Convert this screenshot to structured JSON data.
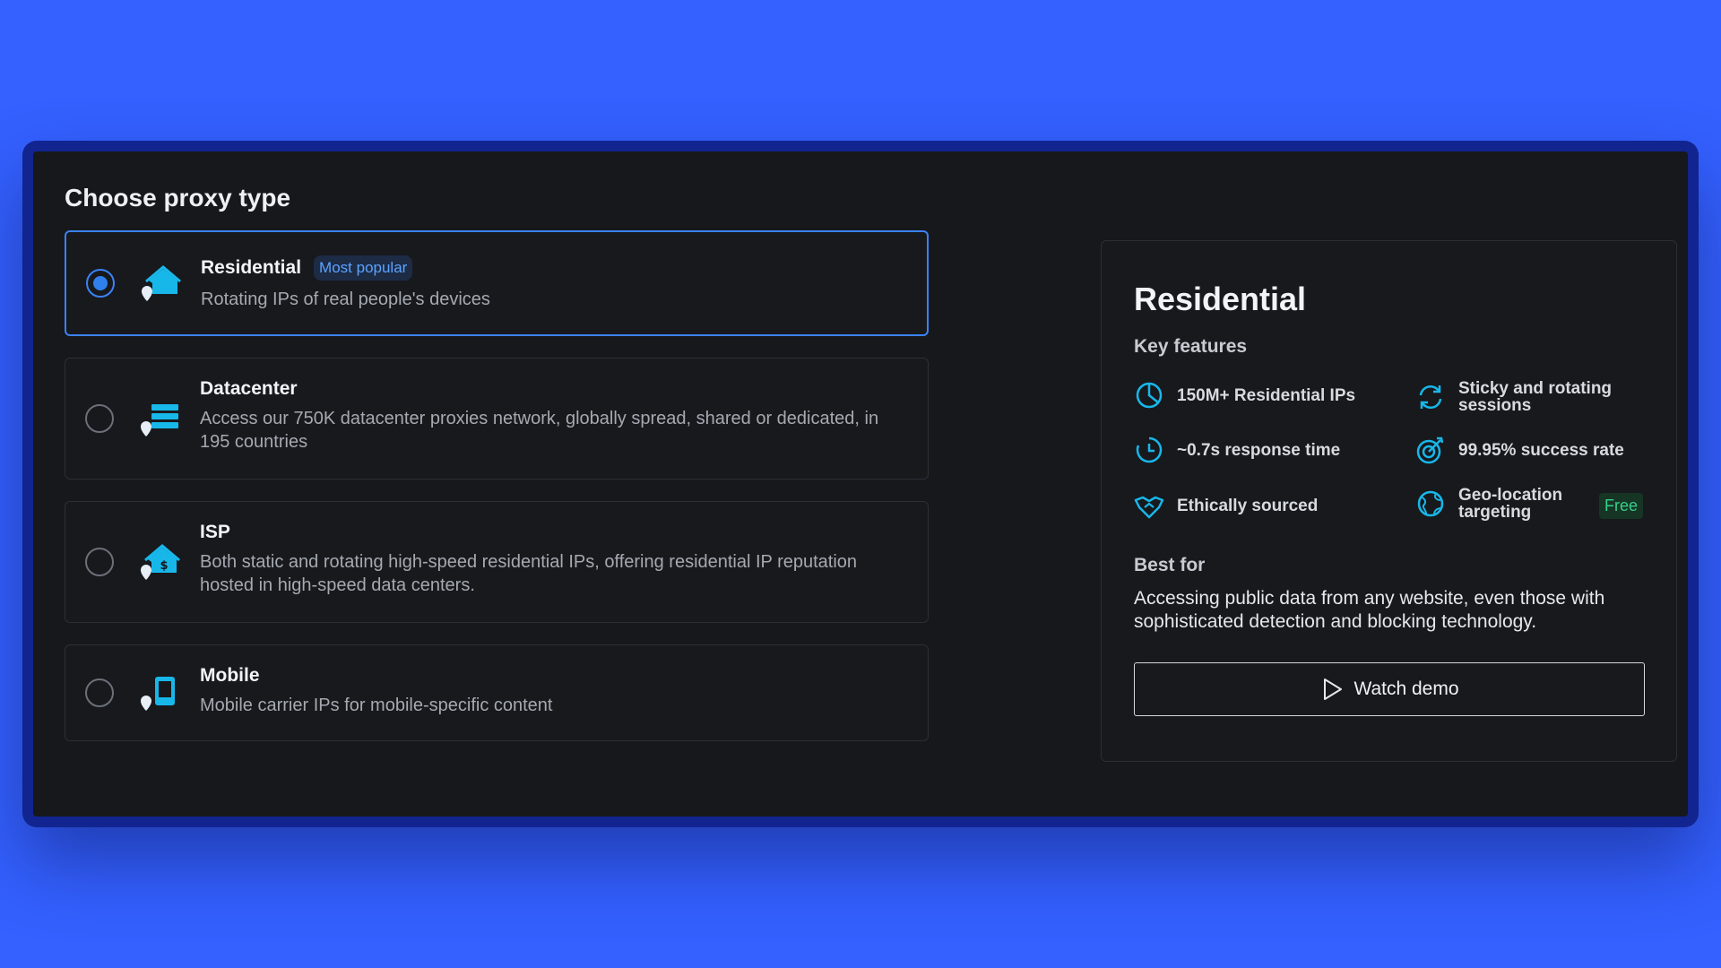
{
  "heading": "Choose proxy type",
  "colors": {
    "accent": "#2f80ed",
    "icon": "#18b7ea",
    "free": "#35d08c"
  },
  "proxy_types": [
    {
      "title": "Residential",
      "badge": "Most popular",
      "description": "Rotating IPs of real people's devices",
      "selected": true,
      "icon": "house-pin-icon"
    },
    {
      "title": "Datacenter",
      "description": "Access our 750K datacenter proxies network, globally spread, shared or dedicated, in 195 countries",
      "selected": false,
      "icon": "server-pin-icon"
    },
    {
      "title": "ISP",
      "description": "Both static and rotating high-speed residential IPs, offering residential IP reputation hosted in high-speed data centers.",
      "selected": false,
      "icon": "house-dollar-pin-icon"
    },
    {
      "title": "Mobile",
      "description": "Mobile carrier IPs for mobile-specific content",
      "selected": false,
      "icon": "phone-pin-icon"
    }
  ],
  "detail": {
    "title": "Residential",
    "features_label": "Key features",
    "features": [
      {
        "text": "150M+ Residential IPs",
        "icon": "pie-chart-icon"
      },
      {
        "text": "Sticky and rotating sessions",
        "icon": "rotate-icon"
      },
      {
        "text": "~0.7s response time",
        "icon": "clock-icon"
      },
      {
        "text": "99.95% success rate",
        "icon": "target-icon"
      },
      {
        "text": "Ethically sourced",
        "icon": "handshake-icon"
      },
      {
        "text": "Geo-location targeting",
        "icon": "globe-icon",
        "badge": "Free"
      }
    ],
    "best_for_label": "Best for",
    "best_for": "Accessing public data from any website, even those with sophisticated detection and blocking technology.",
    "watch_demo": "Watch demo"
  }
}
